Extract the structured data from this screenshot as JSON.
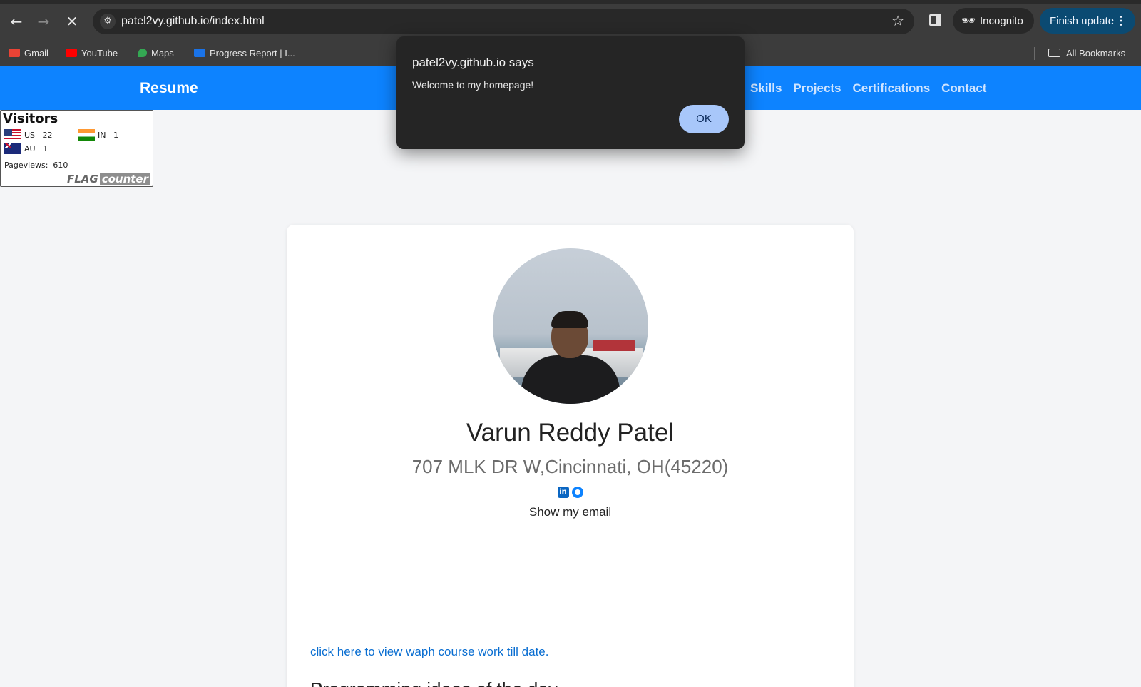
{
  "browser": {
    "url": "patel2vy.github.io/index.html",
    "incognito_label": "Incognito",
    "finish_update_label": "Finish update",
    "bookmarks": [
      {
        "label": "Gmail",
        "color": "#ea4335"
      },
      {
        "label": "YouTube",
        "color": "#ff0000"
      },
      {
        "label": "Maps",
        "color": "#34a853"
      },
      {
        "label": "Progress Report | I...",
        "color": "#1a73e8"
      }
    ],
    "all_bookmarks_label": "All Bookmarks"
  },
  "navbar": {
    "brand": "Resume",
    "links": [
      "Skills",
      "Projects",
      "Certifications",
      "Contact"
    ],
    "color": "#0d83ff"
  },
  "flag_counter": {
    "title": "Visitors",
    "entries": [
      {
        "code": "US",
        "count": "22"
      },
      {
        "code": "IN",
        "count": "1"
      },
      {
        "code": "AU",
        "count": "1"
      }
    ],
    "pageviews_label": "Pageviews:",
    "pageviews_value": "610",
    "logo_text_1": "FLAG",
    "logo_text_2": "counter"
  },
  "profile": {
    "name": "Varun Reddy Patel",
    "address": "707 MLK DR W,Cincinnati, OH(45220)",
    "linkedin_glyph": "in",
    "show_email": "Show my email",
    "coursework_link": "click here to view waph course work till date.",
    "partial_heading": "Programming ideas of the day"
  },
  "dialog": {
    "title": "patel2vy.github.io says",
    "message": "Welcome to my homepage!",
    "ok_label": "OK"
  }
}
